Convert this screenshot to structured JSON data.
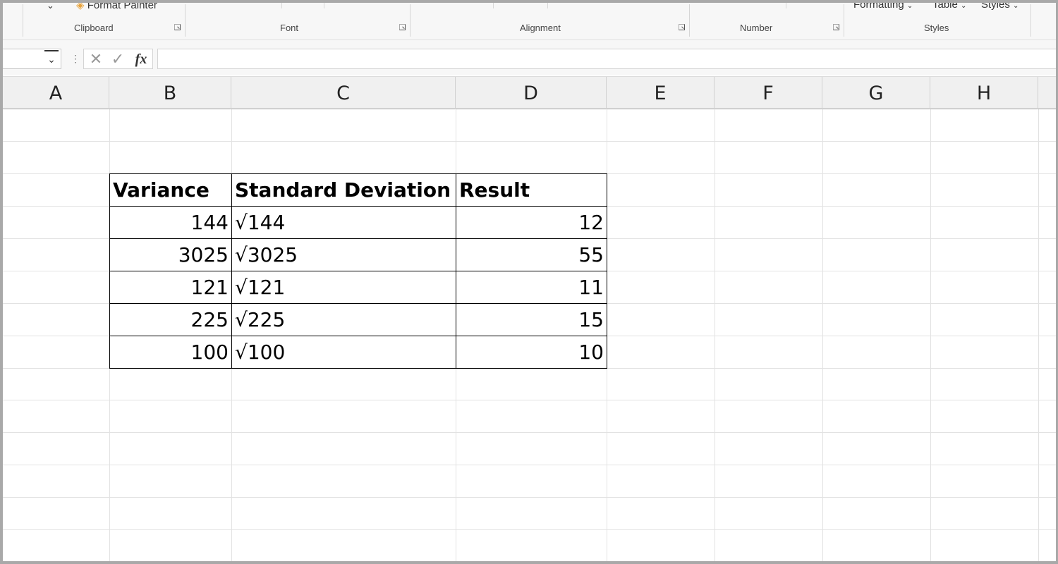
{
  "ribbon": {
    "format_painter_label": "Format Painter",
    "conditional_formatting_label": "Formatting",
    "format_as_table_label": "Table",
    "cell_styles_label": "Styles",
    "groups": [
      "Clipboard",
      "Font",
      "Alignment",
      "Number",
      "Styles"
    ]
  },
  "formula_bar": {
    "name_box_value": "",
    "formula_value": "",
    "fx_label": "fx"
  },
  "columns": [
    "A",
    "B",
    "C",
    "D",
    "E",
    "F",
    "G",
    "H"
  ],
  "table": {
    "headers": [
      "Variance",
      "Standard Deviation",
      "Result"
    ],
    "rows": [
      [
        "144",
        "√144",
        "12"
      ],
      [
        "3025",
        "√3025",
        "55"
      ],
      [
        "121",
        "√121",
        "11"
      ],
      [
        "225",
        "√225",
        "15"
      ],
      [
        "100",
        "√100",
        "10"
      ]
    ]
  },
  "colors": {
    "ribbon_bg": "#f7f7f7",
    "header_bg": "#f0f0f0",
    "gridline": "#e2e2e2",
    "format_painter_icon": "#e8a33c"
  },
  "icons": [
    "format-painter-icon",
    "chevron-down-icon",
    "cancel-x-icon",
    "confirm-check-icon",
    "insert-function-icon",
    "dialog-launcher-icon"
  ]
}
